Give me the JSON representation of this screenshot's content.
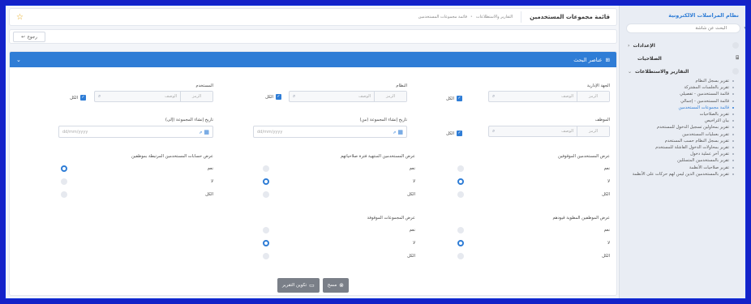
{
  "sidebar": {
    "title": "نظام المراسلات الالكترونية",
    "search_placeholder": "البحث عن شاشة",
    "groups": [
      {
        "label": "الإعدادات",
        "chevron": "‹"
      },
      {
        "label": "الصلاحيات",
        "chevron": ""
      },
      {
        "label": "التقارير والاستطلاعات",
        "chevron": "⌄"
      }
    ],
    "items": [
      "تقرير بسجل النظام",
      "تقرير بالجلسات المشتركة",
      "قائمة المستخدمين - تفصيلي",
      "قائمة المستخدمين - إجمالي",
      "قائمة مجموعات المستخدمين",
      "تقرير بالصلاحيات",
      "بيان التراخيص",
      "تقرير بمحاولين تسجيل الدخول للمستخدم",
      "تقرير بعمليات المستخدمين",
      "تقرير بسجل النظام حسب المستخدم",
      "تقرير بمحاولات الدخول الفاشلة للمستخدم",
      "تقرير آخر عملية دخول",
      "تقرير بالمستخدمين المتسللين",
      "تقرير صلاحيات الأنظمة",
      "تقرير بالمستخدمين الذين ليس لهم حركات على الأنظمة"
    ]
  },
  "header": {
    "title": "قائمة مجموعات المستخدمين",
    "breadcrumb": [
      "التقارير والاستطلاعات",
      "قائمة مجموعات المستخدمين"
    ]
  },
  "toolbar": {
    "back_label": "رجوع"
  },
  "panel": {
    "title": "عناصر البحث"
  },
  "fields": {
    "admin_entity": {
      "label": "الجهة الإدارية",
      "code": "الرمز",
      "desc": "الوصف",
      "all": "الكل"
    },
    "system": {
      "label": "النظام",
      "code": "الرمز",
      "desc": "الوصف",
      "all": "الكل"
    },
    "user": {
      "label": "المستخدم",
      "code": "الرمز",
      "desc": "الوصف",
      "all": "الكل"
    },
    "employee": {
      "label": "الموظف",
      "code": "الرمز",
      "desc": "الوصف",
      "all": "الكل"
    },
    "date_from": {
      "label": "تاريخ إنشاء المجموعة (من)",
      "placeholder": "dd/mm/yyyy",
      "suffix": "م"
    },
    "date_to": {
      "label": "تاريخ إنشاء المجموعة (إلى)",
      "placeholder": "dd/mm/yyyy",
      "suffix": "م"
    }
  },
  "radios": [
    {
      "title": "عرض المستخدمين الموقوفين",
      "options": [
        "نعم",
        "لا",
        "الكل"
      ],
      "selected": 1
    },
    {
      "title": "عرض المستخدمين المنتهية فترة صلاحياتهم",
      "options": [
        "نعم",
        "لا",
        "الكل"
      ],
      "selected": 1
    },
    {
      "title": "عرض حسابات المستخدمين المرتبطة بموظفين",
      "options": [
        "نعم",
        "لا",
        "الكل"
      ],
      "selected": 0
    },
    {
      "title": "عرض الموظفين المطوية قيودهم",
      "options": [
        "نعم",
        "لا",
        "الكل"
      ],
      "selected": 1
    },
    {
      "title": "عرض المجموعات الموقوفة",
      "options": [
        "نعم",
        "لا",
        "الكل"
      ],
      "selected": 1
    }
  ],
  "actions": {
    "generate_label": "تكوين التقرير",
    "clear_label": "مسح"
  },
  "colors": {
    "accent": "#2f7dd6",
    "frame": "#1422c8",
    "star": "#e6a817"
  }
}
